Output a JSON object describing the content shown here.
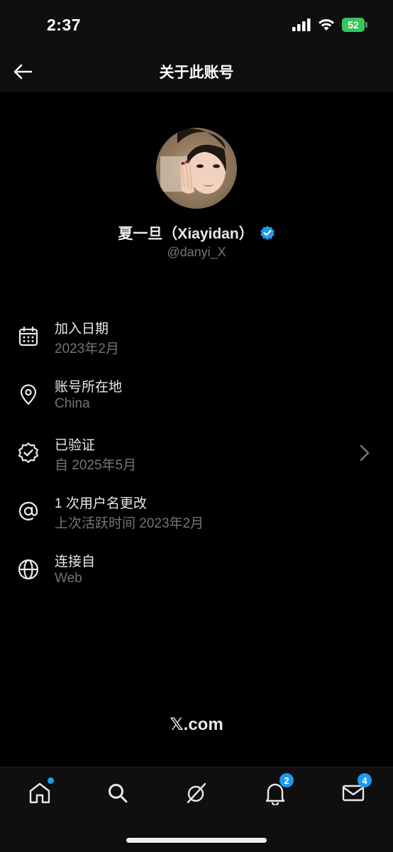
{
  "status": {
    "time": "2:37",
    "battery": "52"
  },
  "header": {
    "title": "关于此账号"
  },
  "profile": {
    "display_name": "夏一旦（Xiayidan）",
    "handle": "@danyi_X"
  },
  "info": [
    {
      "label": "加入日期",
      "value": "2023年2月",
      "icon": "calendar-icon"
    },
    {
      "label": "账号所在地",
      "value": "China",
      "icon": "location-pin-icon"
    },
    {
      "label": "已验证",
      "value": "自 2025年5月",
      "icon": "verified-badge-icon"
    },
    {
      "label": "1 次用户名更改",
      "value": "上次活跃时间 2023年2月",
      "icon": "at-sign-icon"
    },
    {
      "label": "连接自",
      "value": "Web",
      "icon": "globe-icon"
    }
  ],
  "footer": {
    "logo_text": "𝕏.com"
  },
  "tabs": {
    "notifications_badge": "2",
    "messages_badge": "4"
  },
  "colors": {
    "accent": "#1d9bf0",
    "background": "#000000",
    "secondary_text": "#71767b"
  }
}
